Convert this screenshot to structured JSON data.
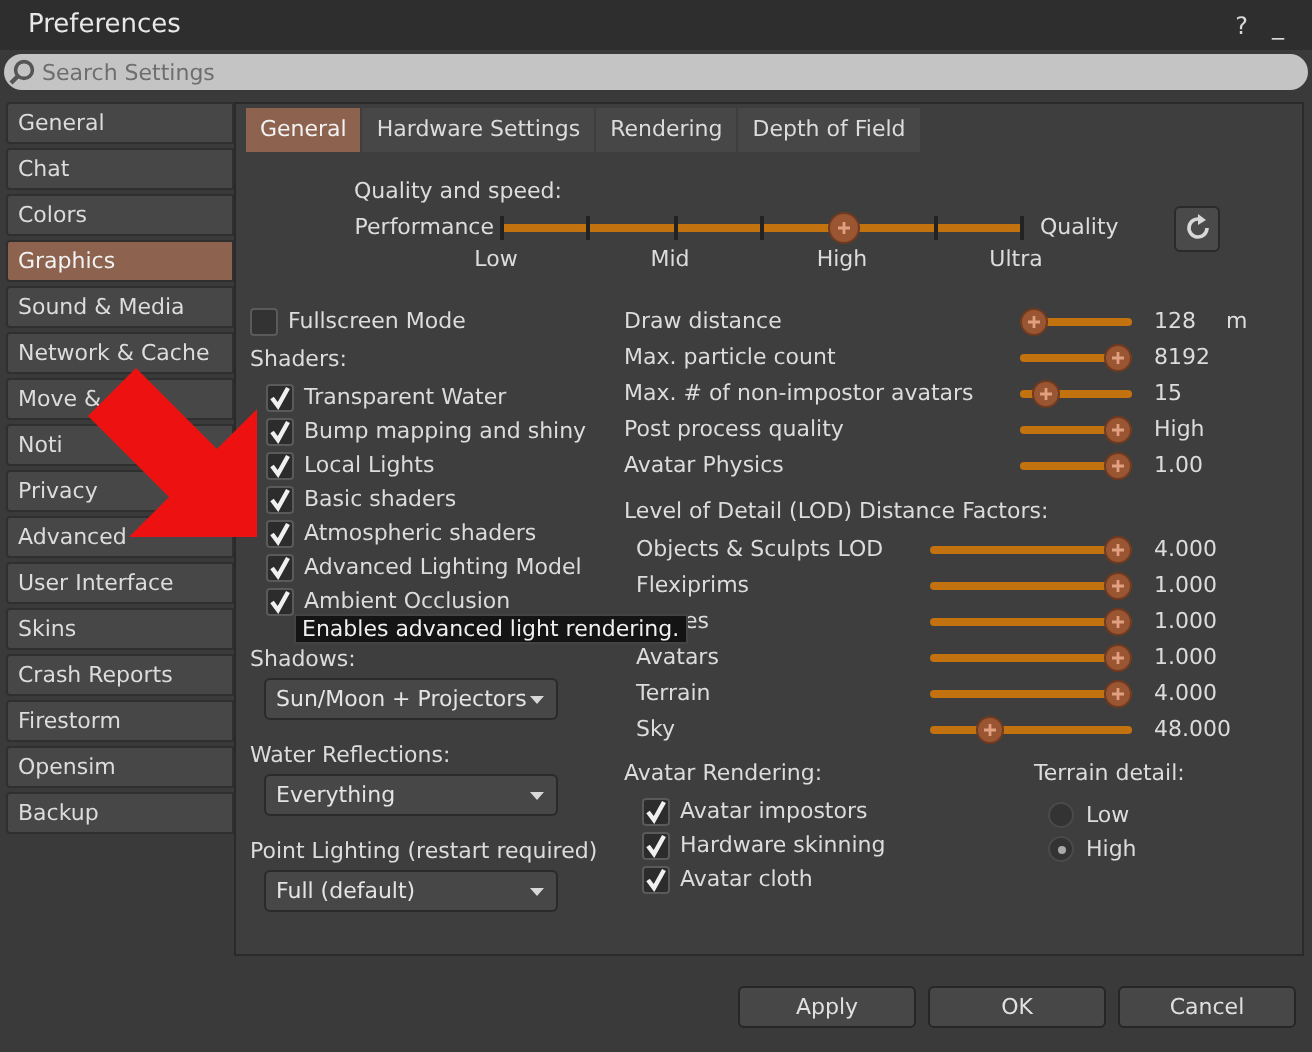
{
  "window": {
    "title": "Preferences",
    "buttons": [
      "?",
      "_"
    ]
  },
  "search": {
    "placeholder": "Search Settings"
  },
  "sidebar": {
    "items": [
      {
        "label": "General",
        "selected": false
      },
      {
        "label": "Chat",
        "selected": false
      },
      {
        "label": "Colors",
        "selected": false
      },
      {
        "label": "Graphics",
        "selected": true
      },
      {
        "label": "Sound & Media",
        "selected": false
      },
      {
        "label": "Network & Cache",
        "selected": false
      },
      {
        "label": "Move &",
        "selected": false
      },
      {
        "label": "Noti",
        "selected": false
      },
      {
        "label": "Privacy",
        "selected": false
      },
      {
        "label": "Advanced",
        "selected": false
      },
      {
        "label": "User Interface",
        "selected": false
      },
      {
        "label": "Skins",
        "selected": false
      },
      {
        "label": "Crash Reports",
        "selected": false
      },
      {
        "label": "Firestorm",
        "selected": false
      },
      {
        "label": "Opensim",
        "selected": false
      },
      {
        "label": "Backup",
        "selected": false
      }
    ]
  },
  "tabs": [
    {
      "label": "General",
      "selected": true
    },
    {
      "label": "Hardware Settings",
      "selected": false
    },
    {
      "label": "Rendering",
      "selected": false
    },
    {
      "label": "Depth of Field",
      "selected": false
    }
  ],
  "quality": {
    "label": "Quality and speed:",
    "left": "Performance",
    "right": "Quality",
    "level": 0.667,
    "ticks": [
      "Low",
      "Mid",
      "High",
      "Ultra"
    ]
  },
  "fullscreen": {
    "label": "Fullscreen Mode",
    "checked": false
  },
  "shaders": {
    "label": "Shaders:",
    "items": [
      {
        "label": "Transparent Water",
        "checked": true
      },
      {
        "label": "Bump mapping and shiny",
        "checked": true
      },
      {
        "label": "Local Lights",
        "checked": true
      },
      {
        "label": "Basic shaders",
        "checked": true
      },
      {
        "label": "Atmospheric shaders",
        "checked": true
      },
      {
        "label": "Advanced Lighting Model",
        "checked": true
      },
      {
        "label": "Ambient Occlusion",
        "checked": true
      }
    ]
  },
  "dropdowns": [
    {
      "label": "Shadows:",
      "value": "Sun/Moon + Projectors"
    },
    {
      "label": "Water Reflections:",
      "value": "Everything"
    },
    {
      "label": "Point Lighting (restart required)",
      "value": "Full (default)"
    }
  ],
  "sliders": [
    {
      "label": "Draw distance",
      "level": 0.0,
      "reading": "128",
      "unit": "m"
    },
    {
      "label": "Max. particle count",
      "level": 1.0,
      "reading": "8192"
    },
    {
      "label": "Max. # of non-impostor avatars",
      "level": 0.15,
      "reading": "15"
    },
    {
      "label": "Post process quality",
      "level": 1.0,
      "reading": "High"
    },
    {
      "label": "Avatar Physics",
      "level": 1.0,
      "reading": "1.00"
    }
  ],
  "lod": {
    "title": "Level of Detail (LOD) Distance Factors:",
    "items": [
      {
        "label": "Objects & Sculpts LOD",
        "level": 1.0,
        "reading": "4.000"
      },
      {
        "label": "Flexiprims",
        "level": 1.0,
        "reading": "1.000"
      },
      {
        "label": "es",
        "level": 1.0,
        "reading": "1.000"
      },
      {
        "label": "Avatars",
        "level": 1.0,
        "reading": "1.000"
      },
      {
        "label": "Terrain",
        "level": 1.0,
        "reading": "4.000"
      },
      {
        "label": "Sky",
        "level": 0.27,
        "reading": "48.000"
      }
    ]
  },
  "avatar_rendering": {
    "title": "Avatar Rendering:",
    "items": [
      {
        "label": "Avatar impostors",
        "checked": true
      },
      {
        "label": "Hardware skinning",
        "checked": true
      },
      {
        "label": "Avatar cloth",
        "checked": true
      }
    ]
  },
  "terrain_detail": {
    "title": "Terrain detail:",
    "options": [
      {
        "label": "Low",
        "selected": false
      },
      {
        "label": "High",
        "selected": true
      }
    ]
  },
  "tooltip": "Enables advanced light rendering.",
  "buttons": [
    "Apply",
    "OK",
    "Cancel"
  ]
}
